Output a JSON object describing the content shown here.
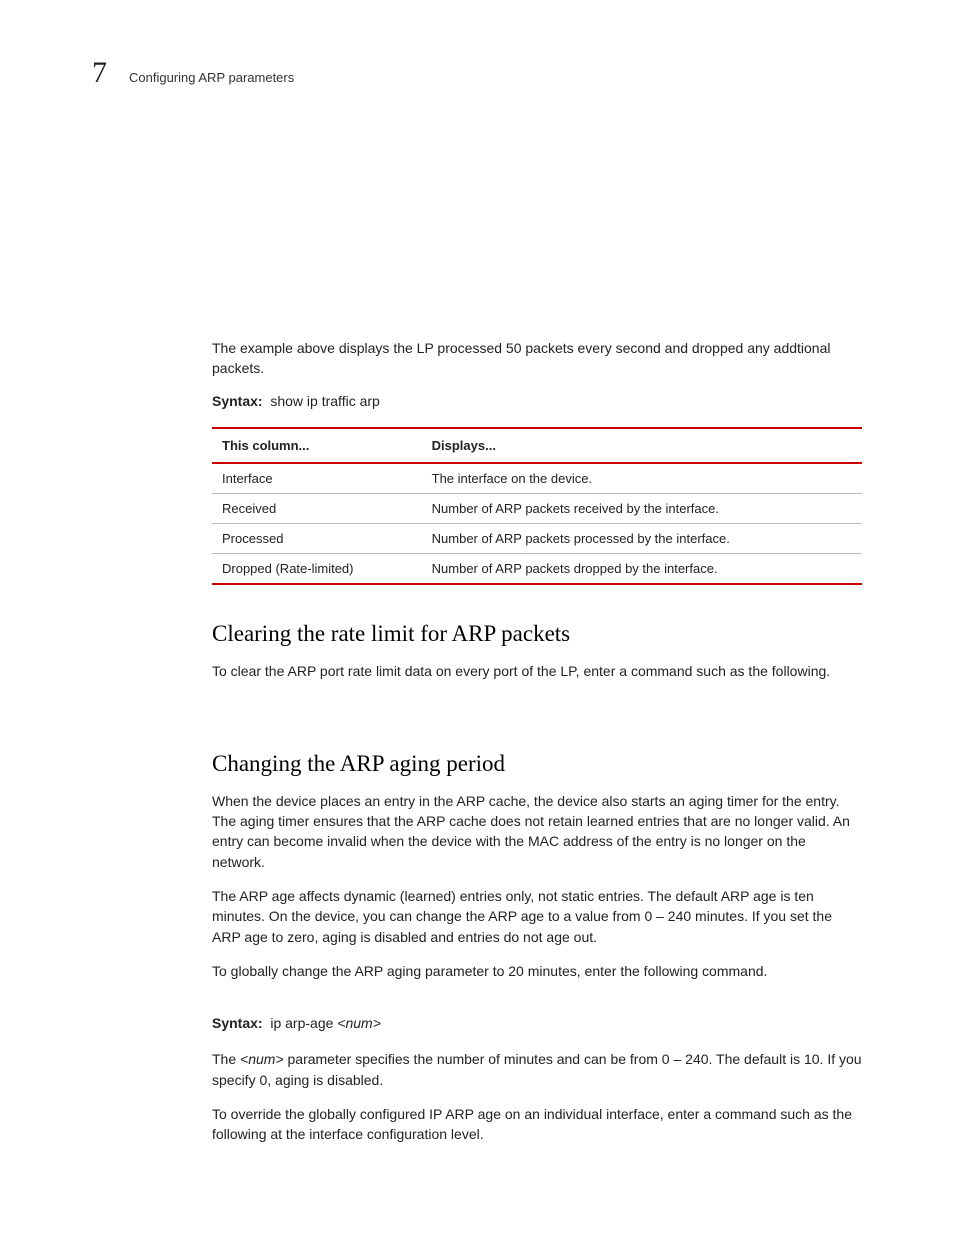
{
  "header": {
    "chapter_number": "7",
    "chapter_title": "Configuring ARP parameters"
  },
  "intro_para": "The example above displays the LP processed 50 packets every second and dropped any addtional packets.",
  "syntax1": {
    "label": "Syntax:",
    "command": "show ip traffic arp"
  },
  "table": {
    "headers": [
      "This column...",
      "Displays..."
    ],
    "rows": [
      [
        "Interface",
        "The interface on the device."
      ],
      [
        "Received",
        "Number of ARP packets received by the interface."
      ],
      [
        "Processed",
        "Number of ARP packets processed by the interface."
      ],
      [
        "Dropped (Rate-limited)",
        "Number of ARP packets dropped by the interface."
      ]
    ]
  },
  "section1": {
    "heading": "Clearing the rate limit for ARP packets",
    "para": "To clear the ARP port rate limit data on every port of the LP,  enter a command such as the following."
  },
  "section2": {
    "heading": "Changing the ARP aging period",
    "para1": "When the device places an entry in the ARP cache, the device also starts an aging timer for the entry. The aging timer ensures that the ARP cache does not retain learned entries that are no longer valid. An entry can become invalid when the device with the MAC address of the entry is no longer on the network.",
    "para2": "The ARP age affects dynamic (learned) entries only, not static entries. The default ARP age is ten minutes. On the device, you can change the ARP age to a value from 0 – 240 minutes. If you set the ARP age to zero, aging is disabled and entries do not age out.",
    "para3": "To globally change the ARP aging parameter to 20 minutes, enter the following command.",
    "syntax": {
      "label": "Syntax:",
      "command": "ip arp-age",
      "arg": "<num>"
    },
    "para4_pre": "The ",
    "para4_arg": "<num>",
    "para4_post": " parameter specifies the number of minutes and can be from 0 – 240. The default is 10. If you specify 0, aging is disabled.",
    "para5": "To override the globally configured IP ARP age on an individual interface, enter a command such as the following at the interface configuration level."
  }
}
